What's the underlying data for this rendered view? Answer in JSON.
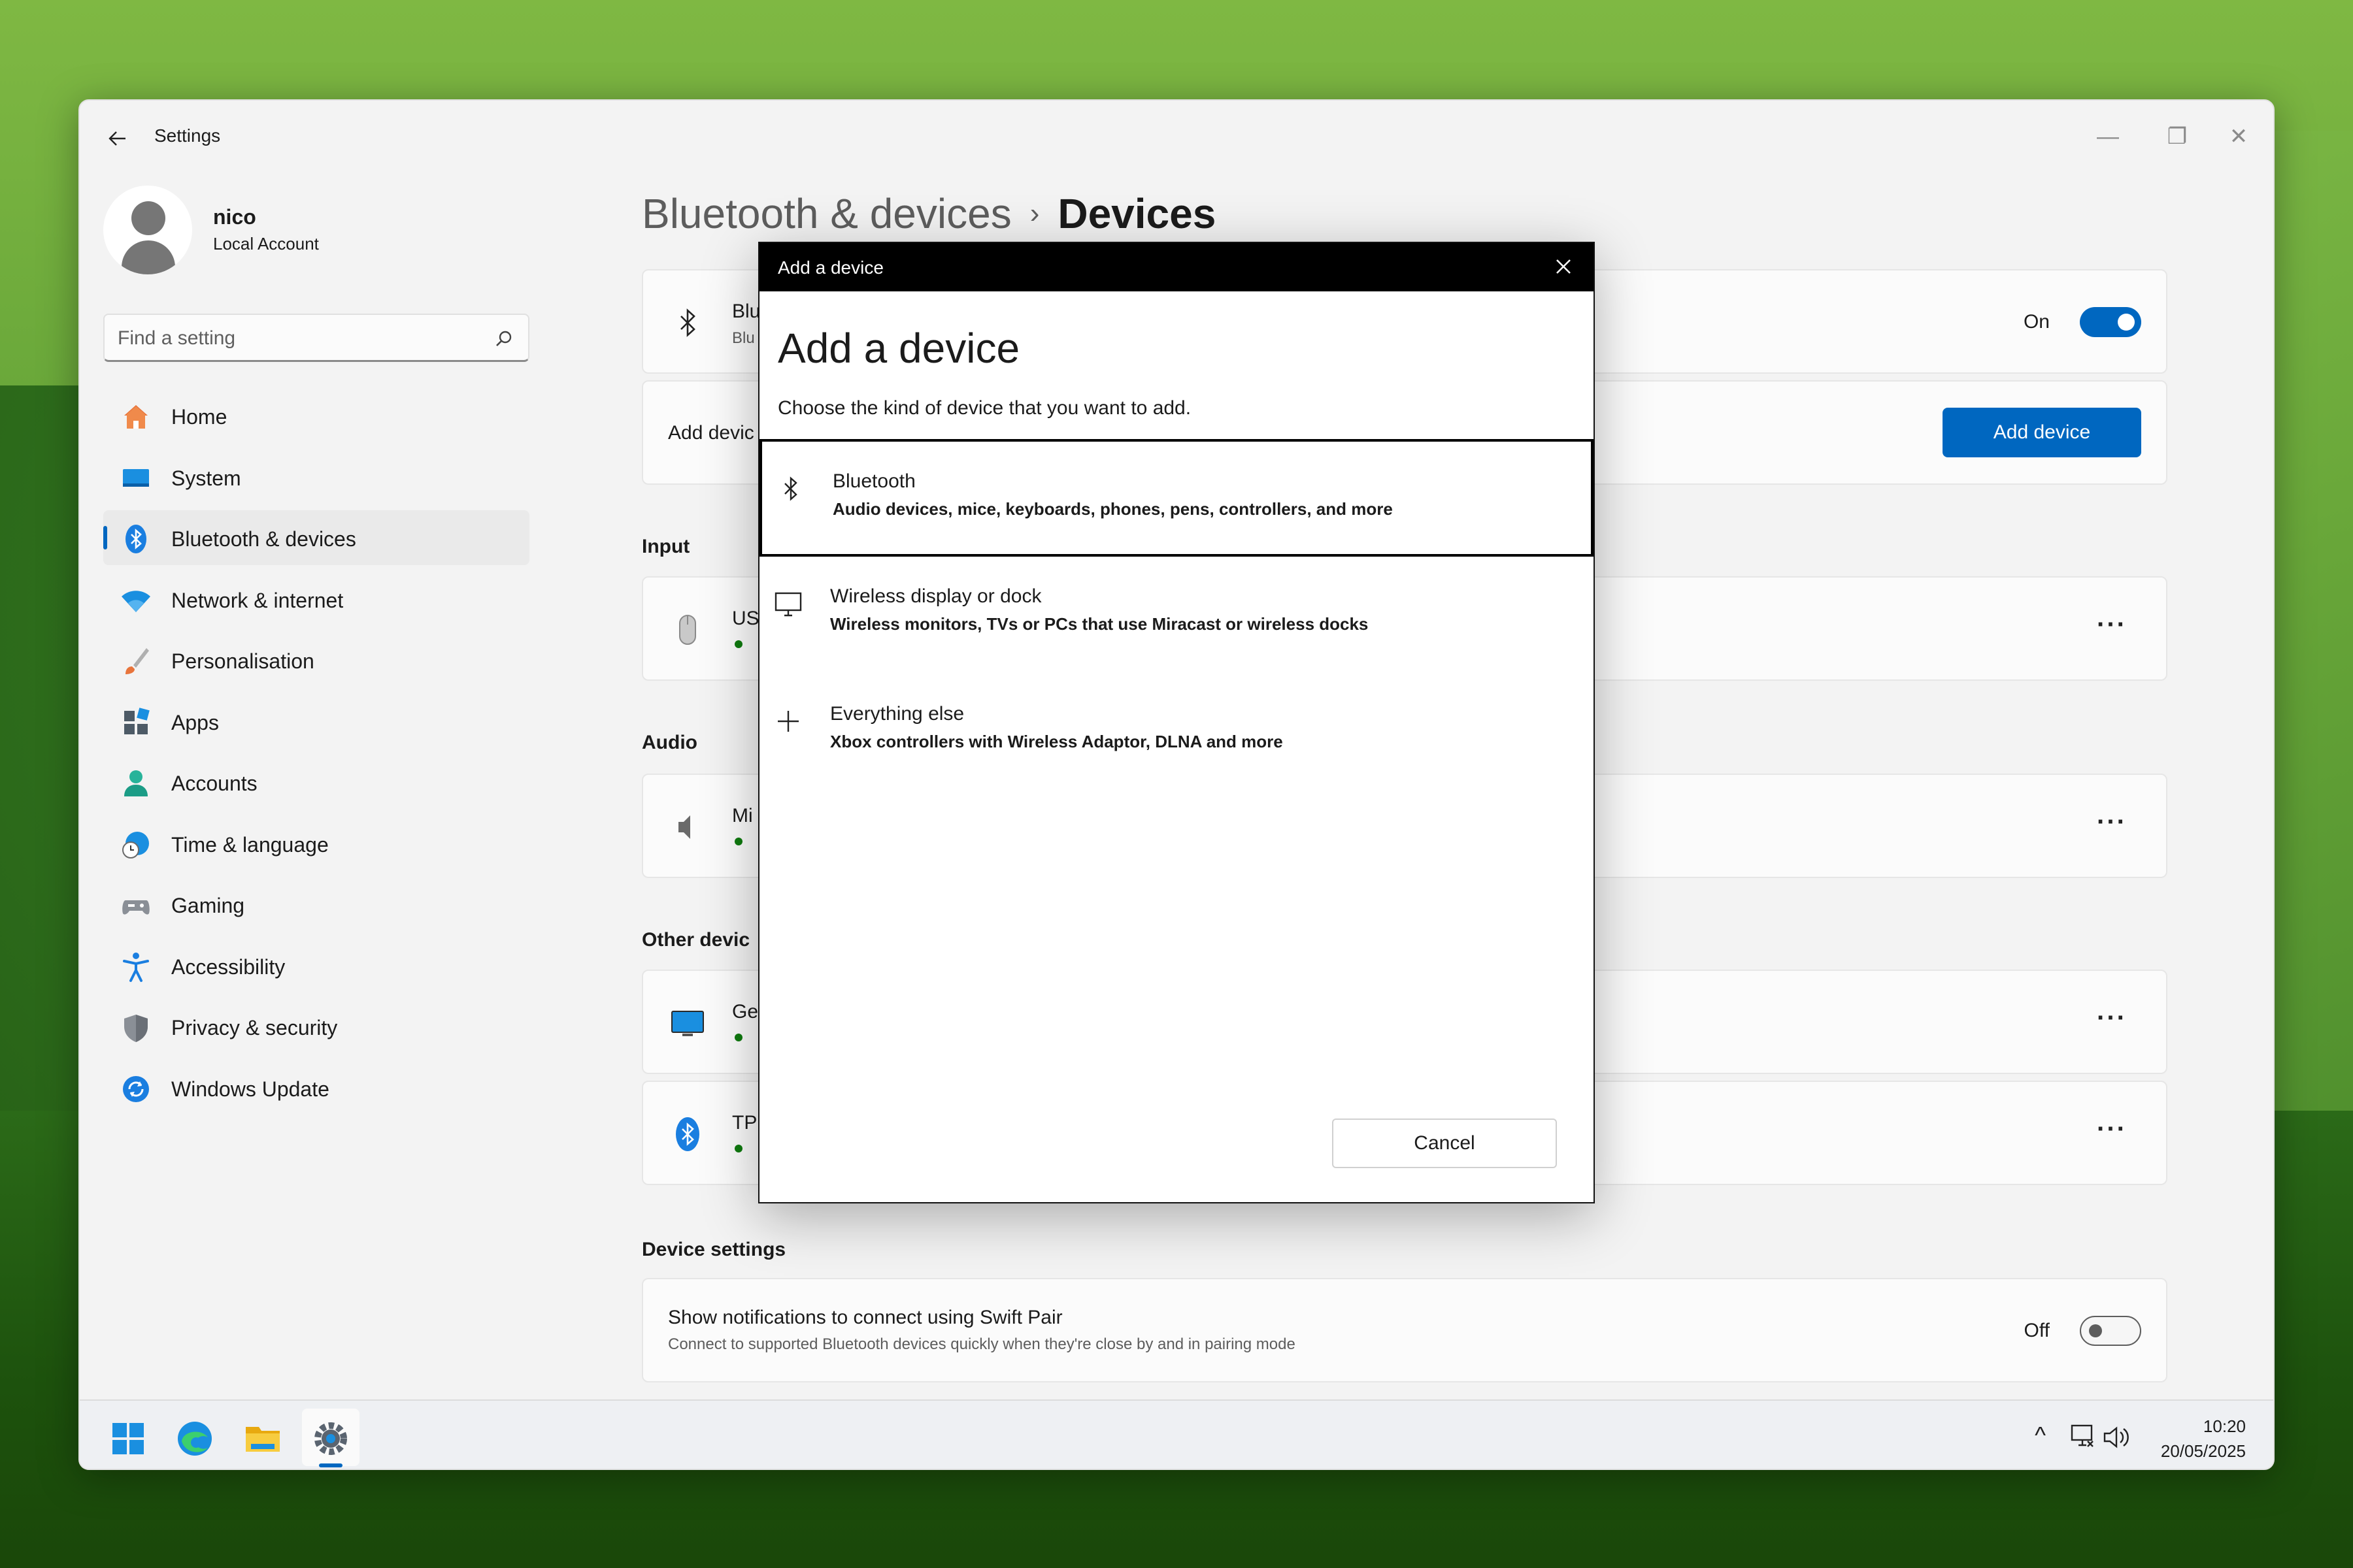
{
  "window": {
    "title": "Settings",
    "controls": {
      "minimize": "—",
      "restore": "❐",
      "close": "✕"
    }
  },
  "user": {
    "name": "nico",
    "account_type": "Local Account"
  },
  "search": {
    "placeholder": "Find a setting",
    "value": ""
  },
  "sidebar": {
    "items": [
      {
        "label": "Home",
        "icon": "home-icon",
        "active": false
      },
      {
        "label": "System",
        "icon": "system-icon",
        "active": false
      },
      {
        "label": "Bluetooth & devices",
        "icon": "bluetooth-icon",
        "active": true
      },
      {
        "label": "Network & internet",
        "icon": "wifi-icon",
        "active": false
      },
      {
        "label": "Personalisation",
        "icon": "brush-icon",
        "active": false
      },
      {
        "label": "Apps",
        "icon": "apps-icon",
        "active": false
      },
      {
        "label": "Accounts",
        "icon": "accounts-icon",
        "active": false
      },
      {
        "label": "Time & language",
        "icon": "clock-globe-icon",
        "active": false
      },
      {
        "label": "Gaming",
        "icon": "gamepad-icon",
        "active": false
      },
      {
        "label": "Accessibility",
        "icon": "accessibility-icon",
        "active": false
      },
      {
        "label": "Privacy & security",
        "icon": "shield-icon",
        "active": false
      },
      {
        "label": "Windows Update",
        "icon": "update-icon",
        "active": false
      }
    ]
  },
  "main": {
    "breadcrumb": {
      "parent": "Bluetooth & devices",
      "separator": "›",
      "current": "Devices"
    },
    "bluetooth_card": {
      "title": "Blu",
      "subtitle": "Blu",
      "toggle_label": "On",
      "toggle_state": "on"
    },
    "add_device_card": {
      "title": "Add devic",
      "button_label": "Add device"
    },
    "sections": {
      "input": "Input",
      "audio": "Audio",
      "other": "Other devic",
      "device_settings": "Device settings"
    },
    "devices": {
      "input_1": {
        "title": "US",
        "icon": "mouse-icon"
      },
      "audio_1": {
        "title": "Mi",
        "icon": "speaker-icon"
      },
      "other_1": {
        "title": "Ge",
        "icon": "monitor-icon"
      },
      "other_2": {
        "title": "TP",
        "icon": "bluetooth-device-icon"
      }
    },
    "more_label": "···",
    "swift_pair": {
      "title": "Show notifications to connect using Swift Pair",
      "subtitle": "Connect to supported Bluetooth devices quickly when they're close by and in pairing mode",
      "toggle_label": "Off",
      "toggle_state": "off"
    }
  },
  "dialog": {
    "titlebar": "Add a device",
    "heading": "Add a device",
    "subtitle": "Choose the kind of device that you want to add.",
    "options": [
      {
        "title": "Bluetooth",
        "subtitle": "Audio devices, mice, keyboards, phones, pens, controllers, and more",
        "icon": "bluetooth-icon",
        "selected": true
      },
      {
        "title": "Wireless display or dock",
        "subtitle": "Wireless monitors, TVs or PCs that use Miracast or wireless docks",
        "icon": "display-icon",
        "selected": false
      },
      {
        "title": "Everything else",
        "subtitle": "Xbox controllers with Wireless Adaptor, DLNA and more",
        "icon": "plus-icon",
        "selected": false
      }
    ],
    "cancel_label": "Cancel"
  },
  "taskbar": {
    "apps": [
      "start-icon",
      "edge-icon",
      "file-explorer-icon",
      "settings-icon"
    ],
    "tray": {
      "chevron": "^"
    },
    "clock": {
      "time": "10:20",
      "date": "20/05/2025"
    }
  }
}
